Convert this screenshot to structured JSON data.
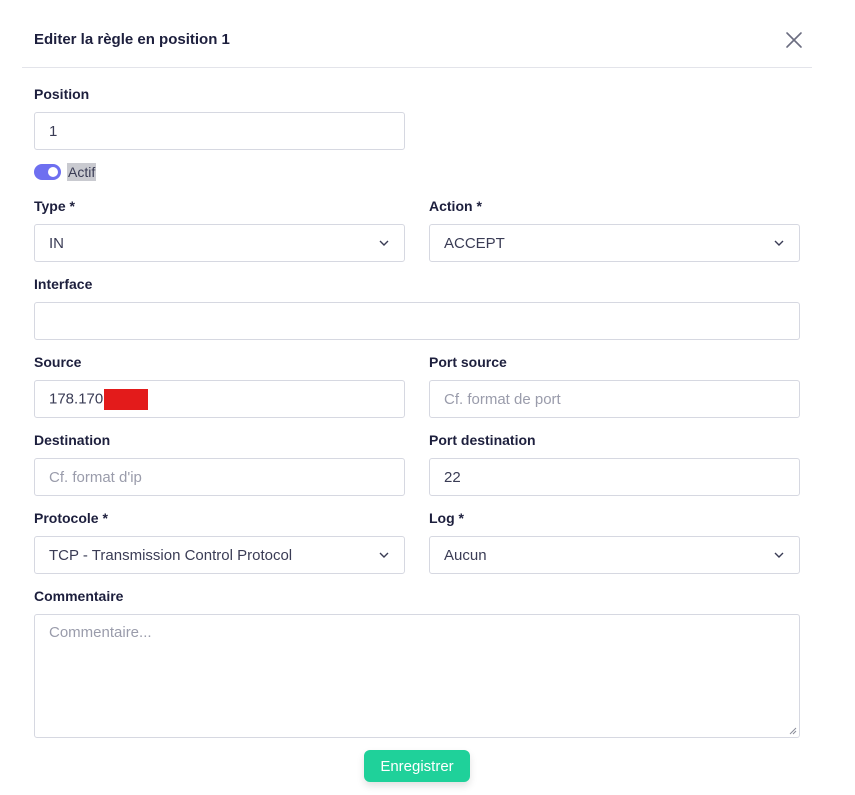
{
  "dialog": {
    "title": "Editer la règle en position 1"
  },
  "form": {
    "position": {
      "label": "Position",
      "value": "1"
    },
    "active": {
      "label": "Actif",
      "checked": true
    },
    "type": {
      "label": "Type *",
      "value": "IN"
    },
    "action": {
      "label": "Action *",
      "value": "ACCEPT"
    },
    "interface": {
      "label": "Interface",
      "value": ""
    },
    "source": {
      "label": "Source",
      "value": "178.170"
    },
    "port_source": {
      "label": "Port source",
      "placeholder": "Cf. format de port"
    },
    "destination": {
      "label": "Destination",
      "placeholder": "Cf. format d'ip"
    },
    "port_destination": {
      "label": "Port destination",
      "value": "22"
    },
    "protocol": {
      "label": "Protocole *",
      "value": "TCP - Transmission Control Protocol"
    },
    "log": {
      "label": "Log *",
      "value": "Aucun"
    },
    "comment": {
      "label": "Commentaire",
      "placeholder": "Commentaire..."
    }
  },
  "buttons": {
    "save_label": "Enregistrer"
  },
  "colors": {
    "accent_toggle": "#6e6ff0",
    "save_button": "#1fd19a",
    "redaction": "#e31b1b"
  },
  "icons": [
    "close-icon",
    "chevron-down-icon",
    "resize-handle-icon"
  ]
}
